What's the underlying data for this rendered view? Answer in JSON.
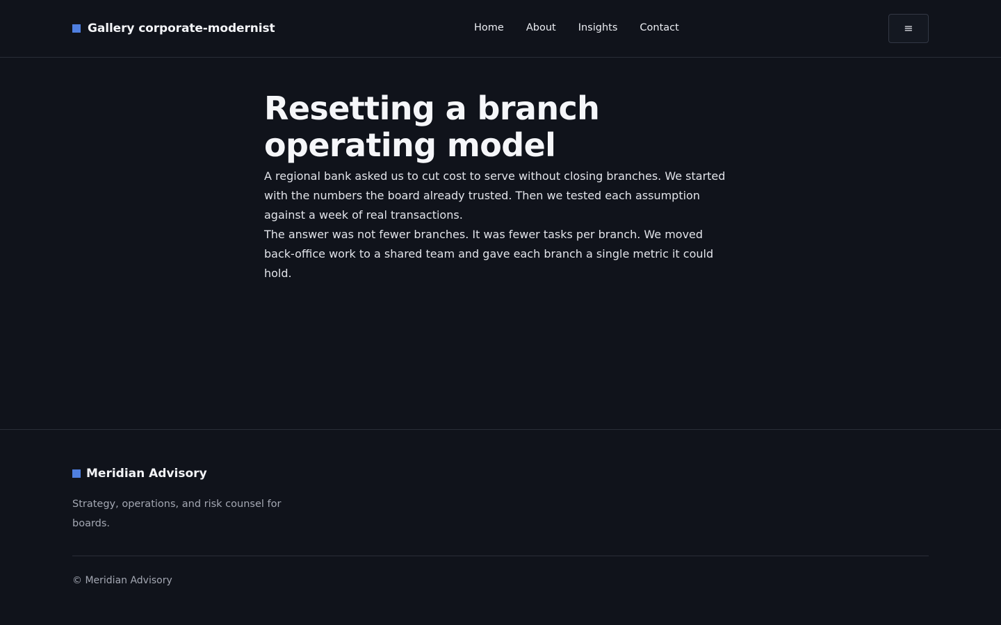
{
  "header": {
    "brand": "Gallery corporate-modernist",
    "nav": [
      {
        "label": "Home"
      },
      {
        "label": "About"
      },
      {
        "label": "Insights"
      },
      {
        "label": "Contact"
      }
    ],
    "menu_icon": "≡"
  },
  "article": {
    "title": "Resetting a branch operating model",
    "paragraphs": [
      "A regional bank asked us to cut cost to serve without closing branches. We started with the numbers the board already trusted. Then we tested each assumption against a week of real transactions.",
      "The answer was not fewer branches. It was fewer tasks per branch. We moved back-office work to a shared team and gave each branch a single metric it could hold."
    ]
  },
  "footer": {
    "brand": "Meridian Advisory",
    "tagline": "Strategy, operations, and risk counsel for boards.",
    "copyright": "© Meridian Advisory"
  },
  "colors": {
    "background": "#10131b",
    "accent": "#4f7fe0",
    "muted_text": "#a4a8b3",
    "divider": "#2a2e38"
  }
}
